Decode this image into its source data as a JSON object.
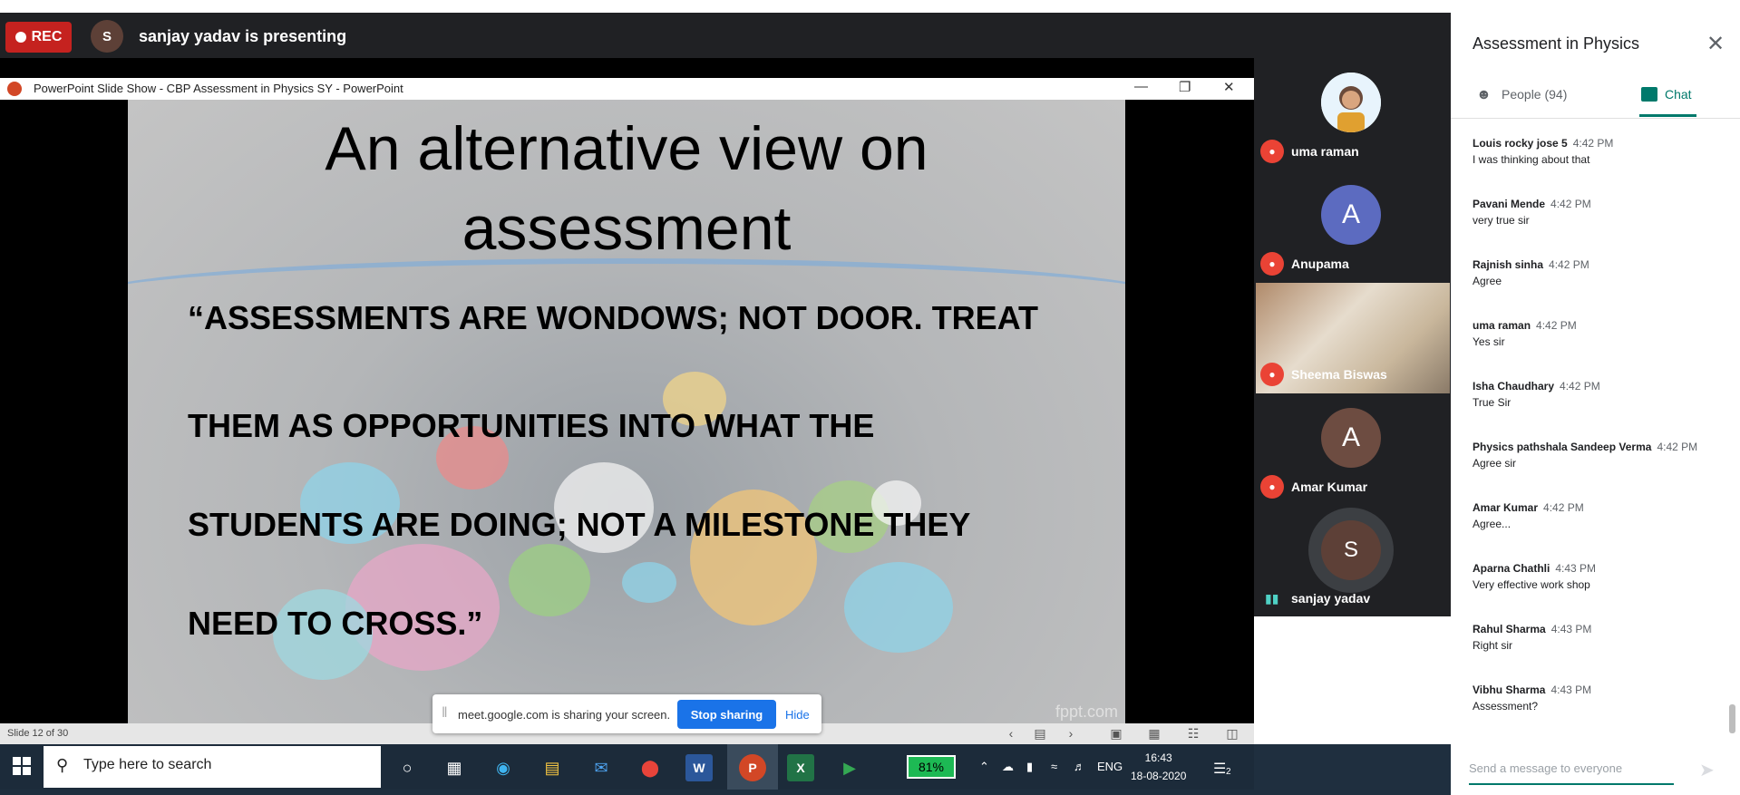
{
  "meet": {
    "rec_label": "REC",
    "presenter_initial": "S",
    "presenter_text": "sanjay yadav is presenting"
  },
  "ppt": {
    "window_title": "PowerPoint Slide Show  -  CBP Assessment in Physics SY - PowerPoint",
    "slide_count": "Slide 12 of 30",
    "slide": {
      "title_line1": "An alternative view on",
      "title_line2": "assessment",
      "quote_lines": [
        "“ASSESSMENTS ARE WONDOWS; NOT DOOR. TREAT",
        "THEM AS OPPORTUNITIES INTO WHAT THE",
        "STUDENTS ARE DOING; NOT A MILESTONE THEY",
        "NEED TO CROSS.”"
      ],
      "brand": "fppt.com"
    }
  },
  "share_banner": {
    "text": "meet.google.com is sharing your screen.",
    "stop_label": "Stop sharing",
    "hide_label": "Hide"
  },
  "participants": [
    {
      "name": "uma raman",
      "initial": "",
      "avatar_color": "#f4f4f4"
    },
    {
      "name": "Anupama",
      "initial": "A",
      "avatar_color": "#5c6bc0"
    },
    {
      "name": "Sheema Biswas",
      "initial": "",
      "avatar_color": "#c9b79c"
    },
    {
      "name": "Amar Kumar",
      "initial": "A",
      "avatar_color": "#6d4c41"
    },
    {
      "name": "sanjay yadav",
      "initial": "S",
      "avatar_color": "#5d4037"
    }
  ],
  "panel": {
    "title": "Assessment in Physics",
    "people_tab": "People (94)",
    "chat_tab": "Chat",
    "input_placeholder": "Send a message to everyone",
    "messages": [
      {
        "name": "Louis rocky jose 5",
        "time": "4:42 PM",
        "text": "I was thinking about that"
      },
      {
        "name": "Pavani Mende",
        "time": "4:42 PM",
        "text": "very true sir"
      },
      {
        "name": "Rajnish sinha",
        "time": "4:42 PM",
        "text": "Agree"
      },
      {
        "name": "uma raman",
        "time": "4:42 PM",
        "text": "Yes sir"
      },
      {
        "name": "Isha Chaudhary",
        "time": "4:42 PM",
        "text": "True Sir"
      },
      {
        "name": "Physics pathshala Sandeep Verma",
        "time": "4:42 PM",
        "text": "Agree sir"
      },
      {
        "name": "Amar Kumar",
        "time": "4:42 PM",
        "text": "Agree..."
      },
      {
        "name": "Aparna Chathli",
        "time": "4:43 PM",
        "text": "Very effective work shop"
      },
      {
        "name": "Rahul Sharma",
        "time": "4:43 PM",
        "text": "Right sir"
      },
      {
        "name": "Vibhu Sharma",
        "time": "4:43 PM",
        "text": "Assessment?"
      }
    ]
  },
  "taskbar": {
    "search_placeholder": "Type here to search",
    "battery": "81%",
    "lang": "ENG",
    "time": "16:43",
    "date": "18-08-2020",
    "notif_count": "2"
  },
  "colors": {
    "rec_red": "#c5221f",
    "meet_teal": "#00796b",
    "stop_blue": "#1a73e8",
    "mute_red": "#ea4335"
  }
}
